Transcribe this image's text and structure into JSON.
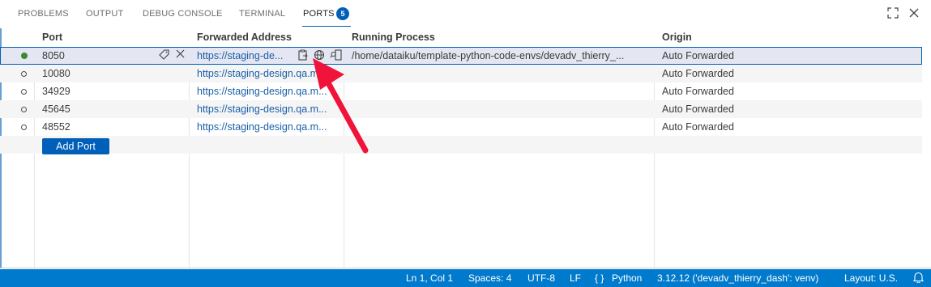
{
  "panel": {
    "tabs": [
      {
        "label": "PROBLEMS"
      },
      {
        "label": "OUTPUT"
      },
      {
        "label": "DEBUG CONSOLE"
      },
      {
        "label": "TERMINAL"
      },
      {
        "label": "PORTS",
        "badge": "5"
      }
    ],
    "active_tab": "PORTS",
    "actions": {
      "maximize_icon": "maximize-icon",
      "close_icon": "close-icon"
    }
  },
  "ports_table": {
    "headers": {
      "port": "Port",
      "address": "Forwarded Address",
      "process": "Running Process",
      "origin": "Origin"
    },
    "rows": [
      {
        "port": "8050",
        "address": "https://staging-de...",
        "process": "/home/dataiku/template-python-code-envs/devadv_thierry_...",
        "origin": "Auto Forwarded",
        "status": "active"
      },
      {
        "port": "10080",
        "address": "https://staging-design.qa.m...",
        "process": "",
        "origin": "Auto Forwarded",
        "status": "idle"
      },
      {
        "port": "34929",
        "address": "https://staging-design.qa.m...",
        "process": "",
        "origin": "Auto Forwarded",
        "status": "idle"
      },
      {
        "port": "45645",
        "address": "https://staging-design.qa.m...",
        "process": "",
        "origin": "Auto Forwarded",
        "status": "idle"
      },
      {
        "port": "48552",
        "address": "https://staging-design.qa.m...",
        "process": "",
        "origin": "Auto Forwarded",
        "status": "idle"
      }
    ],
    "add_port_label": "Add Port",
    "row_action_icons": [
      "tag-icon",
      "close-icon",
      "copy-address-icon",
      "globe-icon",
      "preview-in-editor-icon"
    ]
  },
  "status_bar": {
    "cursor": "Ln 1, Col 1",
    "spaces": "Spaces: 4",
    "encoding": "UTF-8",
    "eol": "LF",
    "language_braces": "{ }",
    "language": "Python",
    "interpreter": "3.12.12 ('devadv_thierry_dash': venv)",
    "layout": "Layout: U.S.",
    "notification_icon": "bell-icon"
  },
  "colors": {
    "accent": "#005fb8",
    "status_bar": "#007acc",
    "active_dot": "#388a34",
    "link": "#1a5fa8",
    "annotation_arrow": "#f0133a"
  }
}
